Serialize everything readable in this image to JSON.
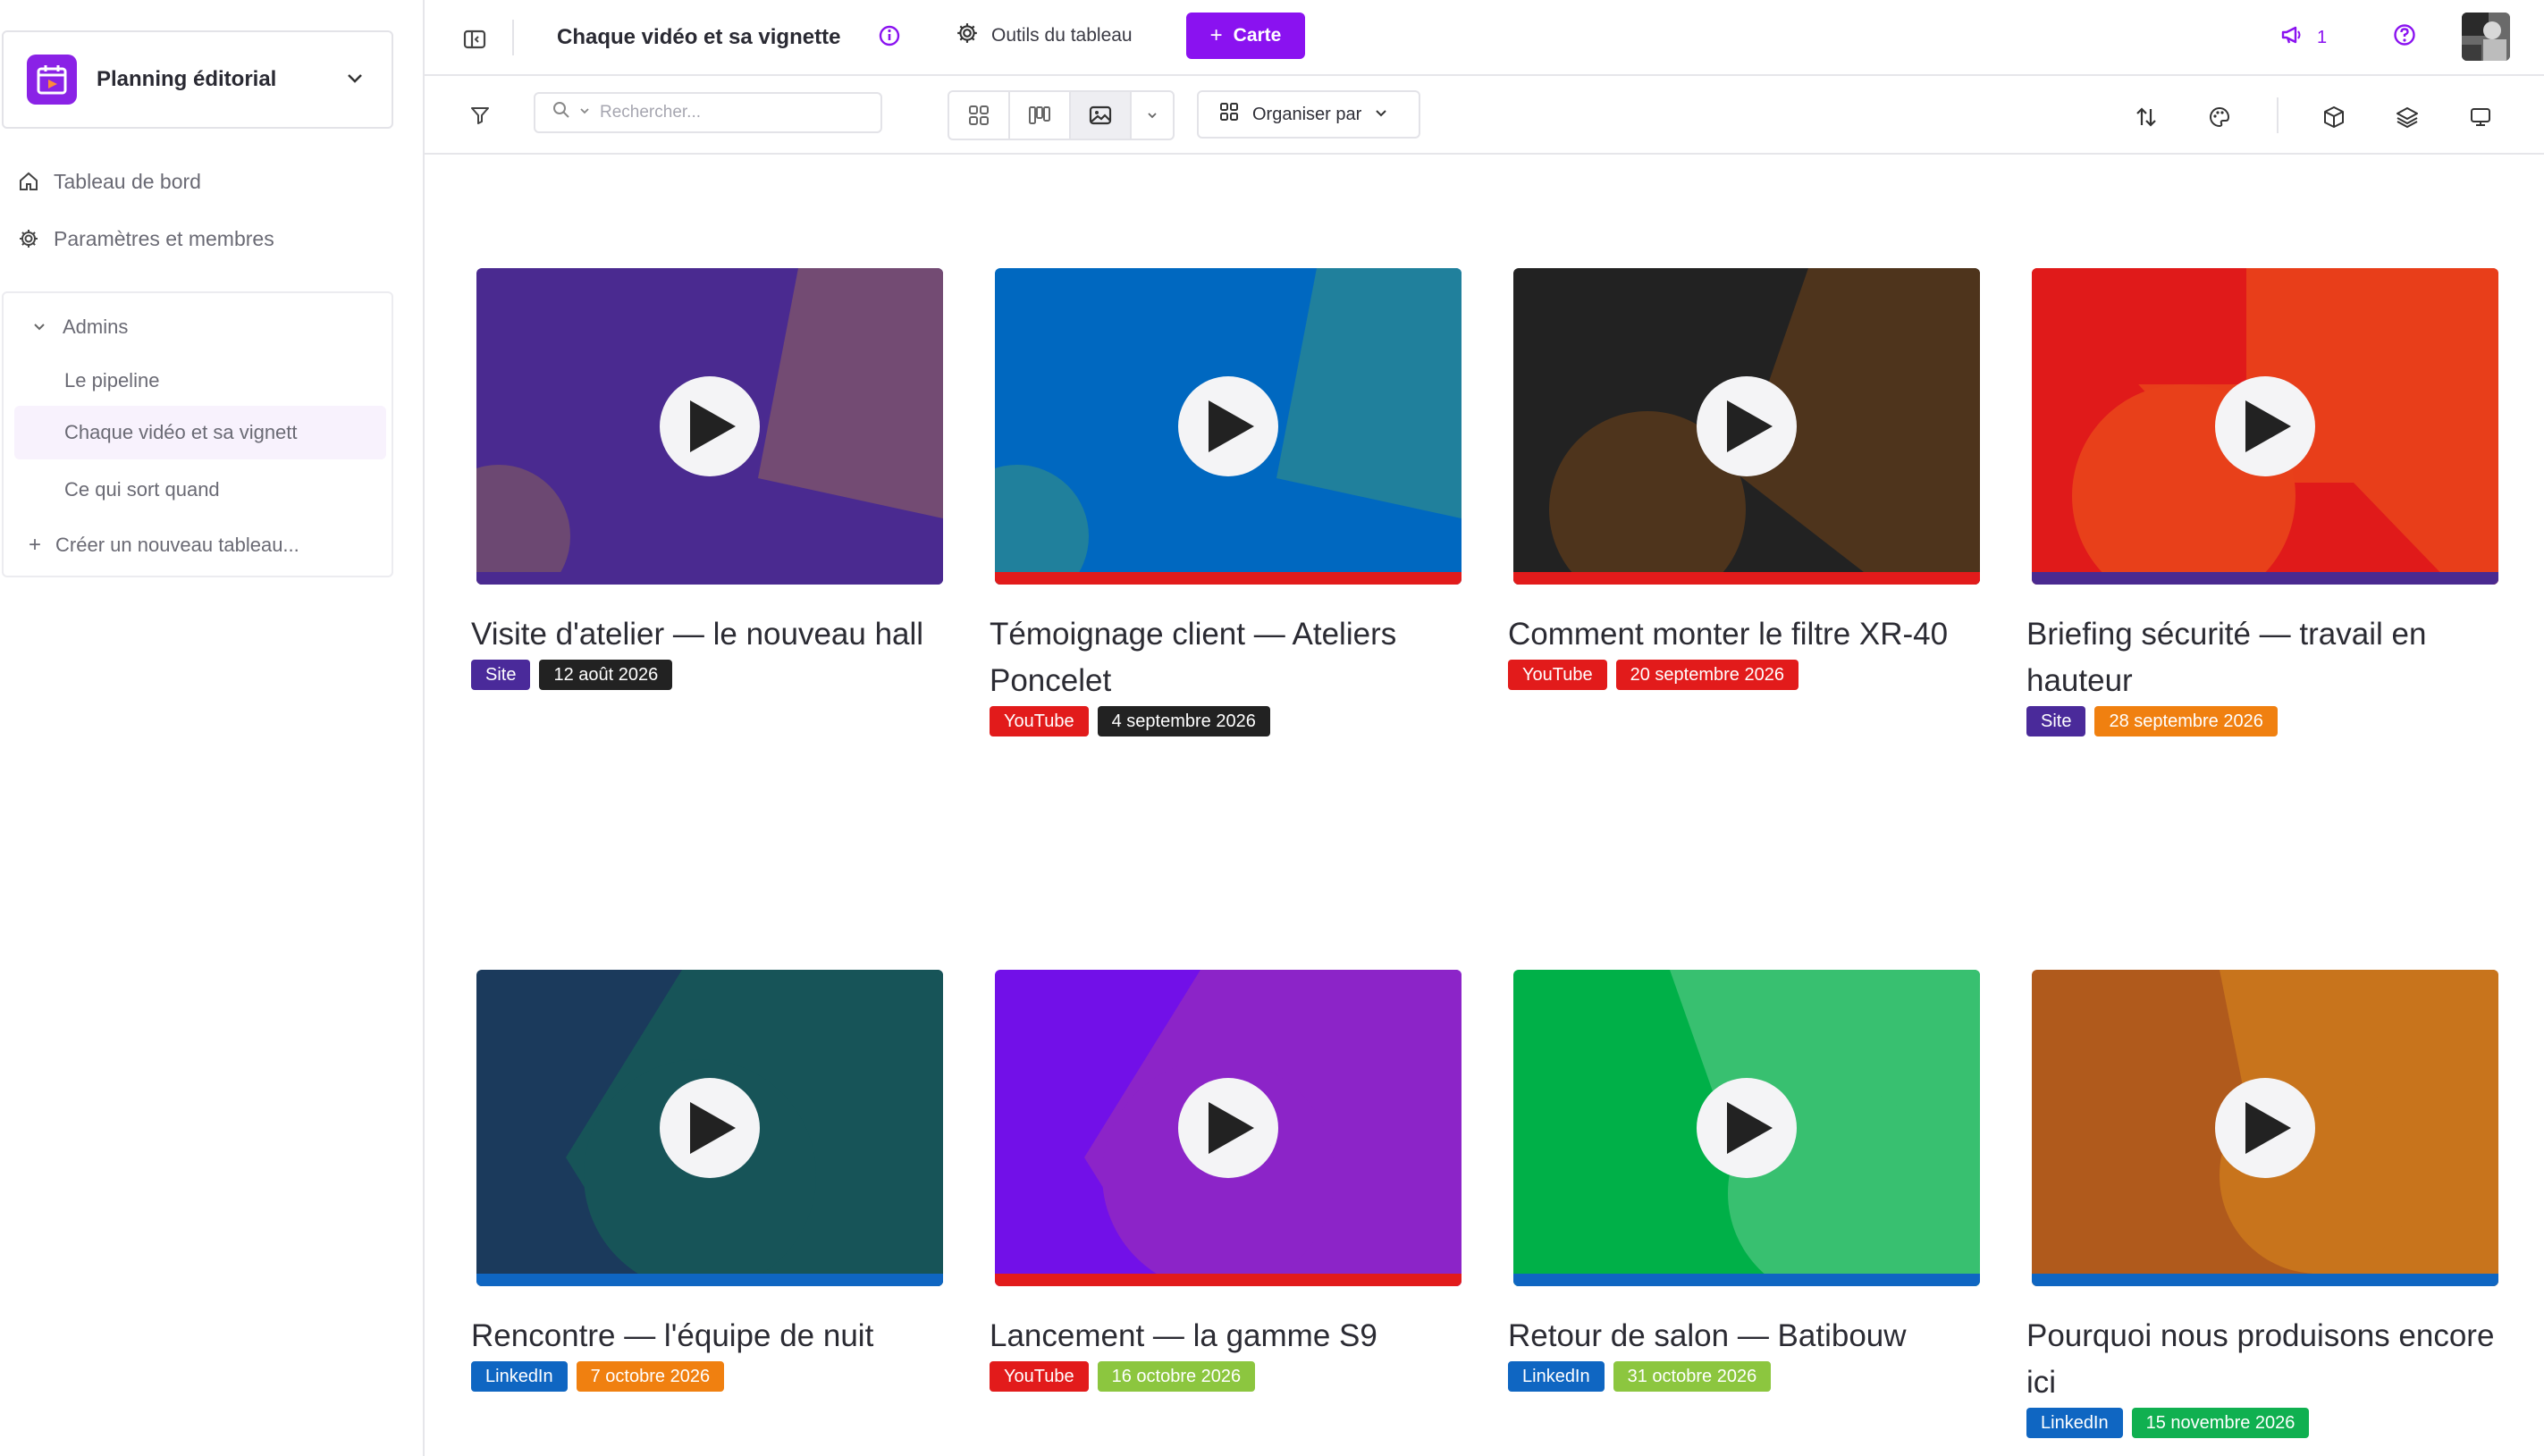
{
  "sidebar": {
    "workspace_name": "Planning éditorial",
    "nav": [
      {
        "label": "Tableau de bord",
        "icon": "home-icon"
      },
      {
        "label": "Paramètres et membres",
        "icon": "gear-icon"
      }
    ],
    "group_label": "Admins",
    "boards": [
      {
        "label": "Le pipeline",
        "active": false
      },
      {
        "label": "Chaque vidéo et sa vignett",
        "active": true
      },
      {
        "label": "Ce qui sort quand",
        "active": false
      }
    ],
    "create_board_label": "Créer un nouveau tableau..."
  },
  "topbar": {
    "board_title": "Chaque vidéo et sa vignette",
    "tools_label": "Outils du tableau",
    "add_card_label": "Carte",
    "notification_count": "1"
  },
  "toolbar": {
    "search_placeholder": "Rechercher...",
    "organize_label": "Organiser par",
    "active_view": "gallery"
  },
  "colors": {
    "accent": "#8a12f0",
    "site": "#4a2a9a",
    "youtube": "#e21b1b",
    "linkedin": "#0f66c2"
  },
  "cards": [
    {
      "title": "Visite d'atelier — le nouveau hall",
      "channel": "Site",
      "channel_color": "#4a2a9a",
      "date": "12 août 2026",
      "date_color": "#222222",
      "bg": "#4a2a90",
      "shape_a": "#734b73",
      "shape_b": "#6c4872",
      "bar": "#4a2a90",
      "variant": 1
    },
    {
      "title": "Témoignage client — Ateliers Poncelet",
      "channel": "YouTube",
      "channel_color": "#e21b1b",
      "date": "4 septembre 2026",
      "date_color": "#222222",
      "bg": "#0068c0",
      "shape_a": "#20809c",
      "shape_b": "#20809c",
      "bar": "#e21b1b",
      "variant": 1
    },
    {
      "title": "Comment monter le filtre XR-40",
      "channel": "YouTube",
      "channel_color": "#e21b1b",
      "date": "20 septembre 2026",
      "date_color": "#e21b1b",
      "bg": "#222222",
      "shape_a": "#4e341c",
      "shape_b": "#4e341c",
      "bar": "#e21b1b",
      "variant": 2
    },
    {
      "title": "Briefing sécurité — travail en hauteur",
      "channel": "Site",
      "channel_color": "#4a2a9a",
      "date": "28 septembre 2026",
      "date_color": "#f08010",
      "bg": "#e01a1a",
      "shape_a": "#e8401a",
      "shape_b": "#e8401a",
      "bar": "#4a2a90",
      "variant": 3
    },
    {
      "title": "Rencontre — l'équipe de nuit",
      "channel": "LinkedIn",
      "channel_color": "#0f66c2",
      "date": "7 octobre 2026",
      "date_color": "#f08010",
      "bg": "#1b3a5c",
      "shape_a": "#175458",
      "shape_b": "#175458",
      "bar": "#0f66c2",
      "variant": 4
    },
    {
      "title": "Lancement — la gamme S9",
      "channel": "YouTube",
      "channel_color": "#e21b1b",
      "date": "16 octobre 2026",
      "date_color": "#8cc63f",
      "bg": "#7210e8",
      "shape_a": "#8c24c8",
      "shape_b": "#8c24c8",
      "bar": "#e21b1b",
      "variant": 4
    },
    {
      "title": "Retour de salon — Batibouw",
      "channel": "LinkedIn",
      "channel_color": "#0f66c2",
      "date": "31 octobre 2026",
      "date_color": "#8cc63f",
      "bg": "#00b048",
      "shape_a": "#38c070",
      "shape_b": "#38c070",
      "bar": "#0f66c2",
      "variant": 5
    },
    {
      "title": "Pourquoi nous produisons encore ici",
      "channel": "LinkedIn",
      "channel_color": "#0f66c2",
      "date": "15 novembre 2026",
      "date_color": "#10b050",
      "bg": "#b05a1c",
      "shape_a": "#c8741c",
      "shape_b": "#c8741c",
      "bar": "#0f66c2",
      "variant": 6
    }
  ]
}
